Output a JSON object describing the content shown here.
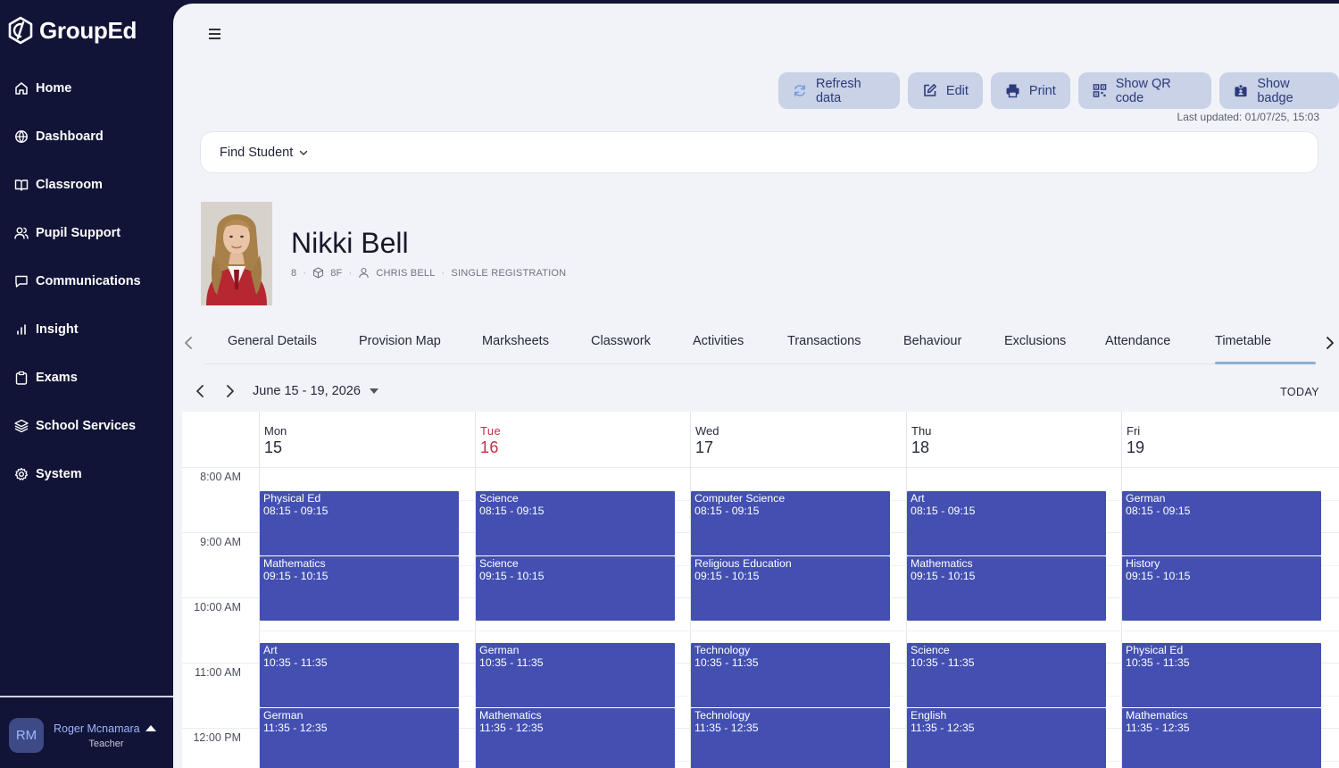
{
  "app": {
    "name": "GroupEd"
  },
  "sidebar": {
    "items": [
      {
        "label": "Home",
        "icon": "home-icon"
      },
      {
        "label": "Dashboard",
        "icon": "globe-icon"
      },
      {
        "label": "Classroom",
        "icon": "book-icon"
      },
      {
        "label": "Pupil Support",
        "icon": "users-icon"
      },
      {
        "label": "Communications",
        "icon": "message-icon"
      },
      {
        "label": "Insight",
        "icon": "bar-chart-icon"
      },
      {
        "label": "Exams",
        "icon": "clipboard-icon"
      },
      {
        "label": "School Services",
        "icon": "layers-icon"
      },
      {
        "label": "System",
        "icon": "gear-icon"
      }
    ]
  },
  "user": {
    "initials": "RM",
    "name": "Roger Mcnamara",
    "role": "Teacher"
  },
  "toolbar": {
    "refresh": "Refresh data",
    "edit": "Edit",
    "print": "Print",
    "qr": "Show QR code",
    "badge": "Show badge",
    "last_updated": "Last updated: 01/07/25, 15:03"
  },
  "find_student": {
    "label": "Find Student"
  },
  "student": {
    "name": "Nikki Bell",
    "year": "8",
    "form": "8F",
    "contact": "CHRIS BELL",
    "registration": "SINGLE REGISTRATION"
  },
  "tabs": [
    "General Details",
    "Provision Map",
    "Marksheets",
    "Classwork",
    "Activities",
    "Transactions",
    "Behaviour",
    "Exclusions",
    "Attendance",
    "Timetable"
  ],
  "active_tab": "Timetable",
  "calendar": {
    "range": "June 15 - 19, 2026",
    "today_label": "TODAY",
    "times": [
      "8:00 AM",
      "9:00 AM",
      "10:00 AM",
      "11:00 AM",
      "12:00 PM"
    ],
    "days": [
      {
        "name": "Mon",
        "num": "15",
        "today": false
      },
      {
        "name": "Tue",
        "num": "16",
        "today": true
      },
      {
        "name": "Wed",
        "num": "17",
        "today": false
      },
      {
        "name": "Thu",
        "num": "18",
        "today": false
      },
      {
        "name": "Fri",
        "num": "19",
        "today": false
      }
    ],
    "events": [
      [
        "Physical Ed",
        "08:15 - 09:15"
      ],
      [
        "Mathematics",
        "09:15 - 10:15"
      ],
      [
        "Art",
        "10:35 - 11:35"
      ],
      [
        "German",
        "11:35 - 12:35"
      ],
      [
        "Science",
        "08:15 - 09:15"
      ],
      [
        "Science",
        "09:15 - 10:15"
      ],
      [
        "German",
        "10:35 - 11:35"
      ],
      [
        "Mathematics",
        "11:35 - 12:35"
      ],
      [
        "Computer Science",
        "08:15 - 09:15"
      ],
      [
        "Religious Education",
        "09:15 - 10:15"
      ],
      [
        "Technology",
        "10:35 - 11:35"
      ],
      [
        "Technology",
        "11:35 - 12:35"
      ],
      [
        "Art",
        "08:15 - 09:15"
      ],
      [
        "Mathematics",
        "09:15 - 10:15"
      ],
      [
        "Science",
        "10:35 - 11:35"
      ],
      [
        "English",
        "11:35 - 12:35"
      ],
      [
        "German",
        "08:15 - 09:15"
      ],
      [
        "History",
        "09:15 - 10:15"
      ],
      [
        "Physical Ed",
        "10:35 - 11:35"
      ],
      [
        "Mathematics",
        "11:35 - 12:35"
      ]
    ]
  },
  "colors": {
    "sidebar": "#111436",
    "event": "#4350b1",
    "button": "#c9d2e6",
    "today": "#c0304a"
  }
}
